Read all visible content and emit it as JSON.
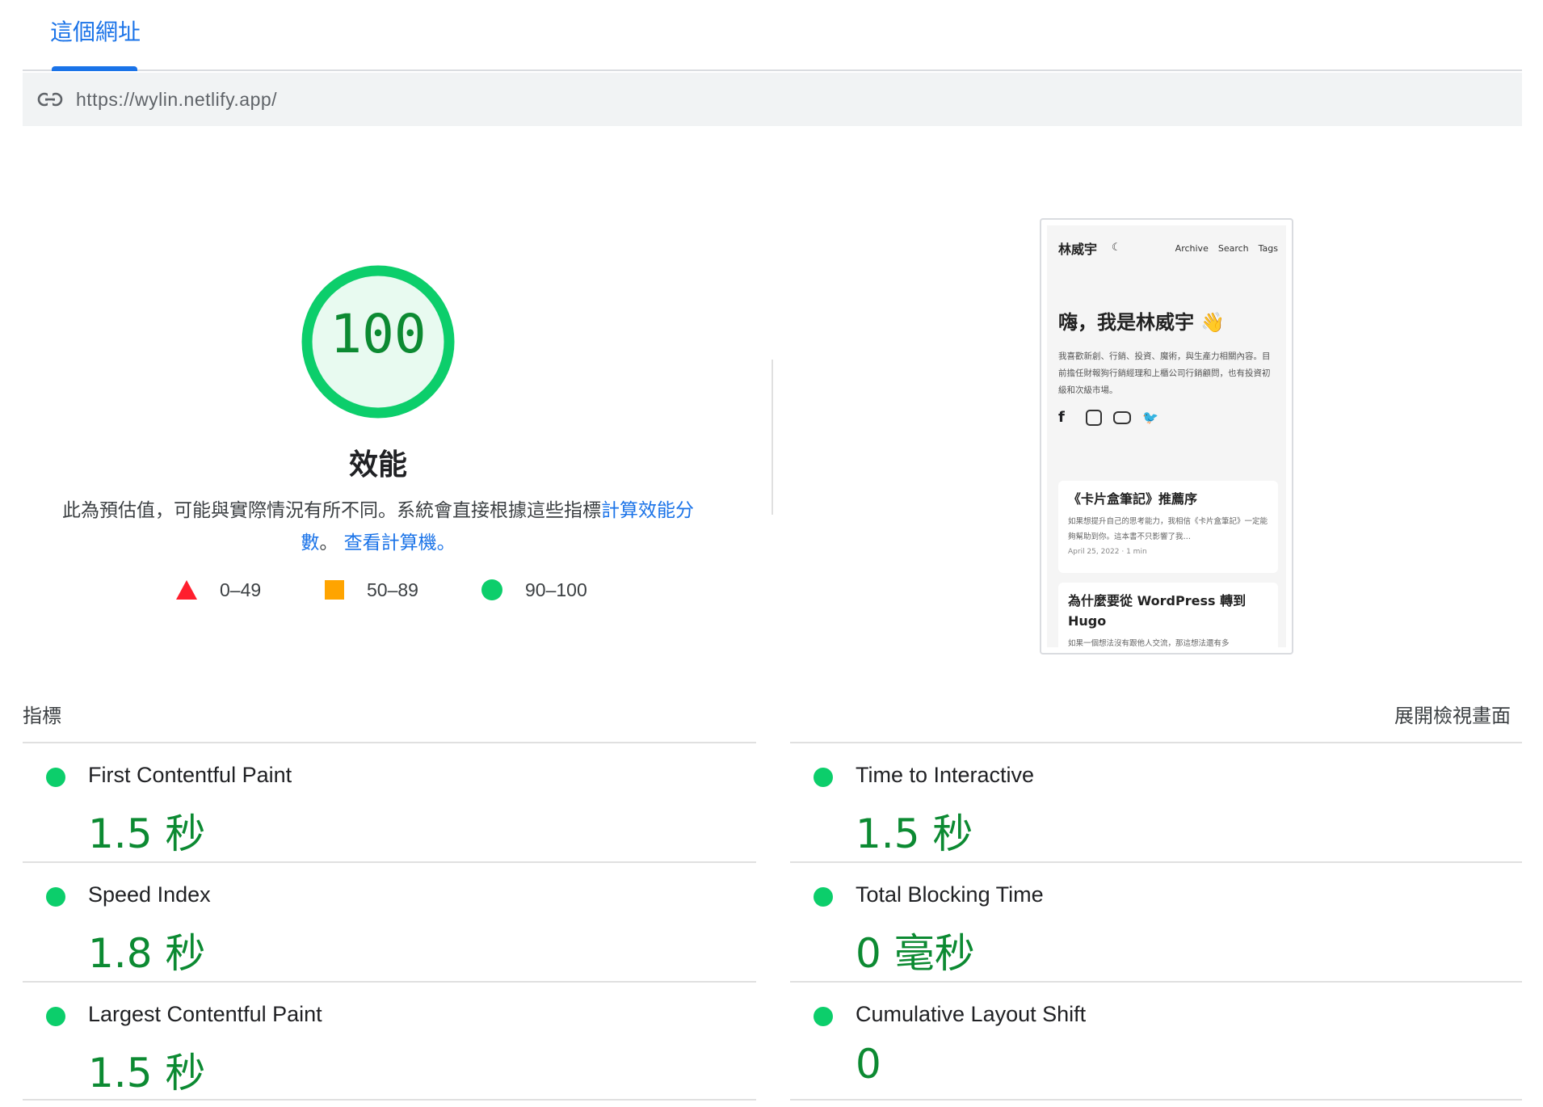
{
  "tab": {
    "label": "這個網址"
  },
  "url_bar": {
    "url": "https://wylin.netlify.app/",
    "icon": "link-icon"
  },
  "score": {
    "value": "100",
    "score_fraction": 1.0,
    "title": "效能",
    "description_text": "此為預估值，可能與實際情況有所不同。系統會直接根據這些指標",
    "description_link": "計算效能分數",
    "description_sep": "。",
    "calculator_link": "查看計算機。",
    "colors": {
      "pass": "#0cce6b",
      "pass_text": "#0c8a32",
      "average": "#ffa400",
      "fail": "#ff1e2d"
    }
  },
  "legend": [
    {
      "range": "0–49",
      "shape": "triangle-icon"
    },
    {
      "range": "50–89",
      "shape": "square-icon"
    },
    {
      "range": "90–100",
      "shape": "circle-icon"
    }
  ],
  "screenshot": {
    "site_name": "林威宇",
    "nav": [
      "Archive",
      "Search",
      "Tags"
    ],
    "hero": "嗨，我是林威宇 👋",
    "bio": "我喜歡新創、行銷、投資、魔術，與生產力相關內容。目前擔任財報狗行銷經理和上櫃公司行銷顧問，也有投資初級和次級市場。",
    "posts": [
      {
        "title": "《卡片盒筆記》推薦序",
        "excerpt": "如果想提升自己的思考能力，我相信《卡片盒筆記》一定能夠幫助到你。這本書不只影響了我…",
        "meta": "April 25, 2022 · 1 min"
      },
      {
        "title": "為什麼要從 WordPress 轉到 Hugo",
        "excerpt": "如果一個想法沒有跟他人交流，那這想法還有多",
        "meta": ""
      }
    ]
  },
  "metrics": {
    "header": "指標",
    "expand_label": "展開檢視畫面",
    "items": [
      {
        "label": "First Contentful Paint",
        "value": "1.5 秒"
      },
      {
        "label": "Time to Interactive",
        "value": "1.5 秒"
      },
      {
        "label": "Speed Index",
        "value": "1.8 秒"
      },
      {
        "label": "Total Blocking Time",
        "value": "0 毫秒"
      },
      {
        "label": "Largest Contentful Paint",
        "value": "1.5 秒"
      },
      {
        "label": "Cumulative Layout Shift",
        "value": "0"
      }
    ]
  }
}
